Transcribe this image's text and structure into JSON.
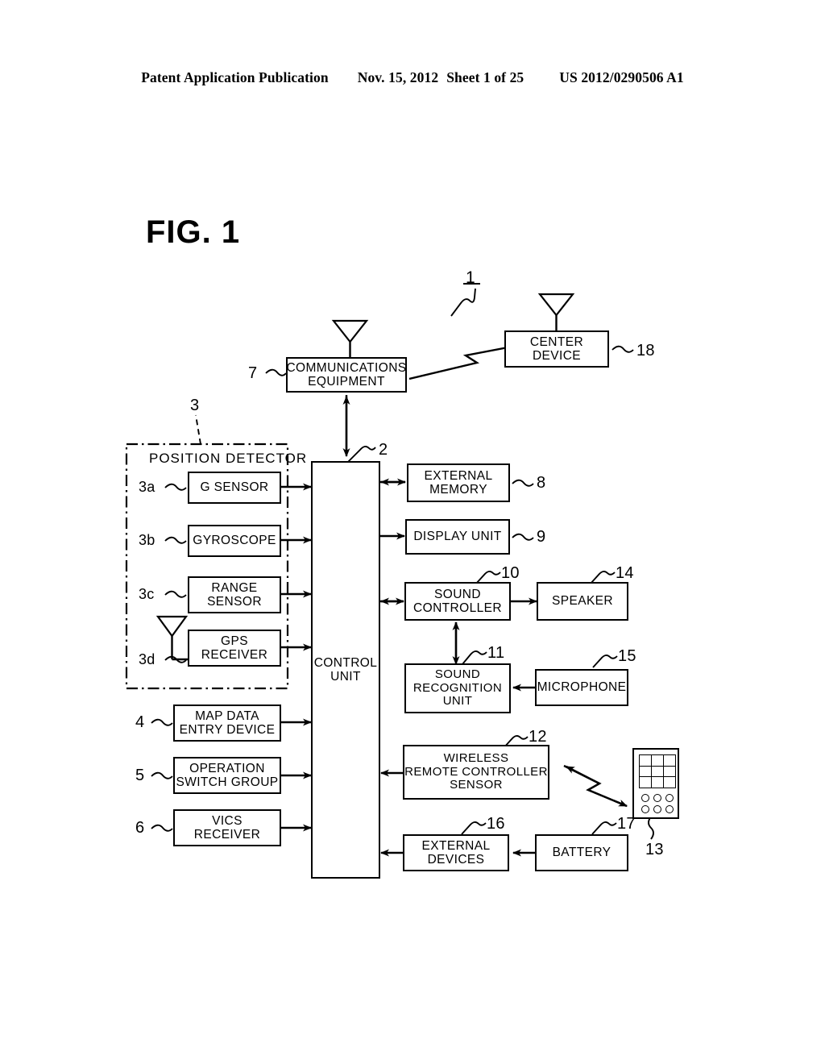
{
  "header": {
    "publication": "Patent Application Publication",
    "date": "Nov. 15, 2012",
    "sheet": "Sheet 1 of 25",
    "docnum": "US 2012/0290506 A1"
  },
  "figure": {
    "label": "FIG. 1",
    "system_ref": "1"
  },
  "position_detector": {
    "title": "POSITION DETECTOR",
    "ref": "3",
    "sensors": [
      {
        "label": "G SENSOR",
        "ref": "3a"
      },
      {
        "label": "GYROSCOPE",
        "ref": "3b"
      },
      {
        "label": "RANGE\nSENSOR",
        "ref": "3c"
      },
      {
        "label": "GPS\nRECEIVER",
        "ref": "3d"
      }
    ]
  },
  "blocks": {
    "communications_equipment": {
      "label": "COMMUNICATIONS\nEQUIPMENT",
      "ref": "7"
    },
    "center_device": {
      "label": "CENTER\nDEVICE",
      "ref": "18"
    },
    "control_unit": {
      "label": "CONTROL\nUNIT",
      "ref": "2"
    },
    "external_memory": {
      "label": "EXTERNAL\nMEMORY",
      "ref": "8"
    },
    "display_unit": {
      "label": "DISPLAY UNIT",
      "ref": "9"
    },
    "sound_controller": {
      "label": "SOUND\nCONTROLLER",
      "ref": "10"
    },
    "speaker": {
      "label": "SPEAKER",
      "ref": "14"
    },
    "sound_recognition_unit": {
      "label": "SOUND\nRECOGNITION\nUNIT",
      "ref": "11"
    },
    "microphone": {
      "label": "MICROPHONE",
      "ref": "15"
    },
    "wireless_remote_sensor": {
      "label": "WIRELESS\nREMOTE CONTROLLER\nSENSOR",
      "ref": "12"
    },
    "remote_controller": {
      "label": "",
      "ref": "13"
    },
    "external_devices": {
      "label": "EXTERNAL\nDEVICES",
      "ref": "16"
    },
    "battery": {
      "label": "BATTERY",
      "ref": "17"
    },
    "map_data_entry_device": {
      "label": "MAP DATA\nENTRY DEVICE",
      "ref": "4"
    },
    "operation_switch_group": {
      "label": "OPERATION\nSWITCH GROUP",
      "ref": "5"
    },
    "vics_receiver": {
      "label": "VICS\nRECEIVER",
      "ref": "6"
    }
  },
  "colors": {
    "ink": "#000000",
    "paper": "#ffffff"
  }
}
